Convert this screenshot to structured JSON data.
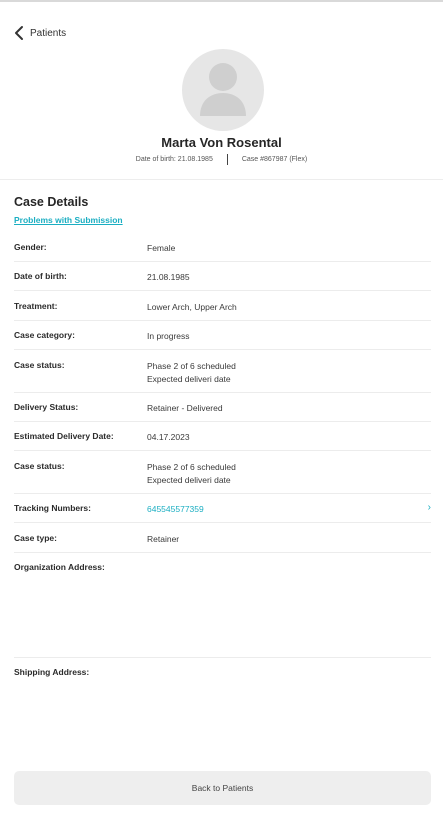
{
  "nav": {
    "back_label": "Patients",
    "back_icon": "chevron-left-icon"
  },
  "profile": {
    "name": "Marta Von Rosental",
    "dob_text": "Date of birth: 21.08.1985",
    "case_text": "Case #867987 (Flex)"
  },
  "section": {
    "title": "Case Details",
    "problems_link": "Problems with Submission"
  },
  "details": {
    "gender": {
      "label": "Gender:",
      "value": "Female"
    },
    "dob": {
      "label": "Date of birth:",
      "value": "21.08.1985"
    },
    "treatment": {
      "label": "Treatment:",
      "value": "Lower Arch, Upper Arch"
    },
    "case_category": {
      "label": "Case category:",
      "value": "In progress"
    },
    "case_status_1": {
      "label": "Case status:",
      "value_line1": "Phase 2 of 6 scheduled",
      "value_line2": "Expected deliveri date"
    },
    "delivery_status": {
      "label": "Delivery Status:",
      "value": "Retainer - Delivered"
    },
    "estimated_delivery": {
      "label": "Estimated Delivery Date:",
      "value": "04.17.2023"
    },
    "case_status_2": {
      "label": "Case status:",
      "value_line1": "Phase 2 of 6 scheduled",
      "value_line2": "Expected deliveri date"
    },
    "tracking": {
      "label": "Tracking Numbers:",
      "value": "645545577359",
      "arrow": "›"
    },
    "case_type": {
      "label": "Case type:",
      "value": "Retainer"
    },
    "org_address": {
      "label": "Organization Address:"
    },
    "shipping_address": {
      "label": "Shipping Address:"
    }
  },
  "footer": {
    "back_button": "Back to Patients"
  },
  "colors": {
    "accent": "#1aaec2",
    "avatar_bg": "#e6e6e6",
    "button_bg": "#eeeeee"
  }
}
